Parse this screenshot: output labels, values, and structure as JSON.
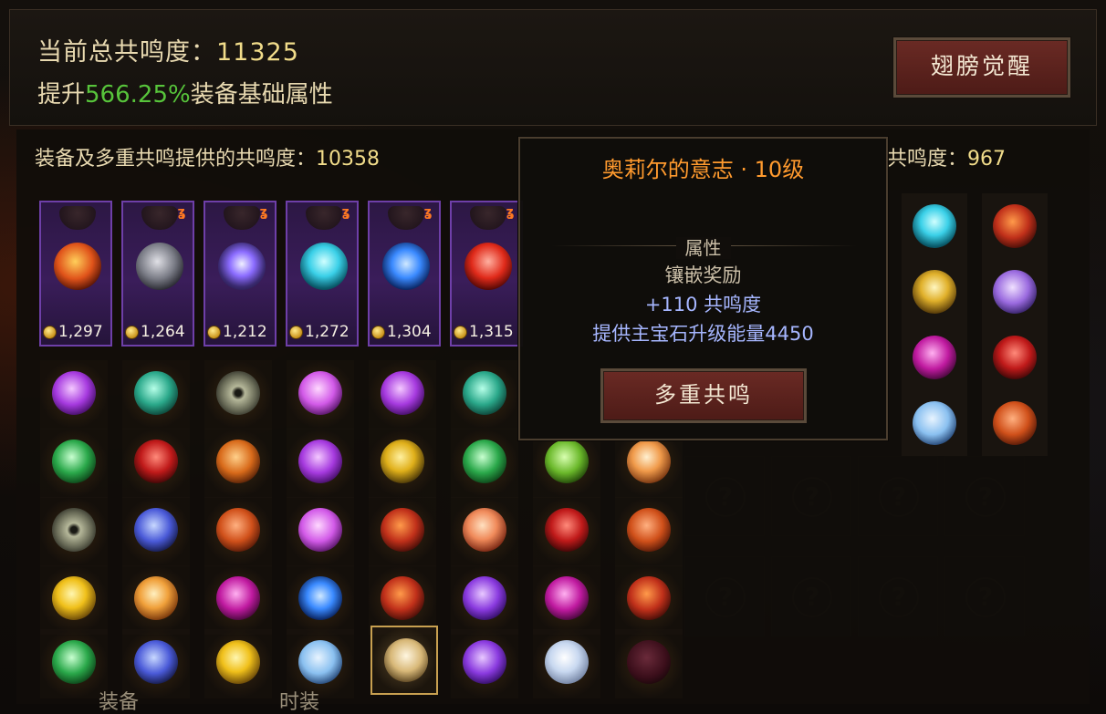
{
  "summary": {
    "total_label": "当前总共鸣度：",
    "total_value": "11325",
    "boost_prefix": "提升",
    "boost_pct": "566.25%",
    "boost_suffix": "装备基础属性",
    "awaken_button": "翅膀觉醒"
  },
  "stats": {
    "left_label": "装备及多重共鸣提供的共鸣度：",
    "left_value": "10358",
    "right_label": "共鸣度：",
    "right_value": "967"
  },
  "equipment": [
    {
      "value": "1,297",
      "orb": "fire",
      "badge": false
    },
    {
      "value": "1,264",
      "orb": "silver",
      "badge": true
    },
    {
      "value": "1,212",
      "orb": "violet",
      "badge": true
    },
    {
      "value": "1,272",
      "orb": "cyan",
      "badge": true
    },
    {
      "value": "1,304",
      "orb": "blue",
      "badge": true
    },
    {
      "value": "1,315",
      "orb": "red",
      "badge": true
    }
  ],
  "tooltip": {
    "title": "奥莉尔的意志 · 10级",
    "section": "属性",
    "line1": "镶嵌奖励",
    "line2": "+110 共鸣度",
    "line3": "提供主宝石升级能量4450",
    "button": "多重共鸣"
  },
  "bottom_tabs": [
    "装备",
    "时装"
  ],
  "colors": {
    "accent_orange": "#ff9a2e",
    "boost_green": "#57c43b",
    "stat_blue": "#a6b6ff",
    "card_purple": "#6e3fa8"
  }
}
